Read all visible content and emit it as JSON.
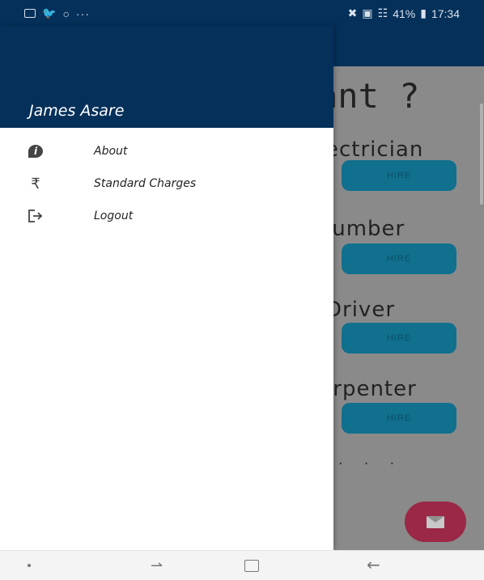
{
  "status_bar": {
    "battery": "41%",
    "time": "17:34",
    "left_icons": [
      "gallery-icon",
      "twitter-icon",
      "whatsapp-icon"
    ],
    "overflow": "···"
  },
  "drawer": {
    "user_name": "James Asare",
    "items": [
      {
        "label": "About",
        "icon": "info-icon"
      },
      {
        "label": "Standard Charges",
        "icon": "rupee-icon"
      },
      {
        "label": "Logout",
        "icon": "logout-icon"
      }
    ],
    "header_color": "#04305a"
  },
  "background_app": {
    "title_fragment": "ant ?",
    "services": [
      {
        "name": "ectrician",
        "button": "HIRE"
      },
      {
        "name": "lumber",
        "button": "HIRE"
      },
      {
        "name": "Driver",
        "button": "HIRE"
      },
      {
        "name": ".rpenter",
        "button": "HIRE"
      }
    ],
    "hire_color": "#10708e",
    "fab_color": "#9a2846",
    "fab_icon": "mail-icon"
  },
  "nav_bar": {
    "icons": [
      "dot-icon",
      "recent-apps-icon",
      "home-icon",
      "back-icon"
    ]
  }
}
